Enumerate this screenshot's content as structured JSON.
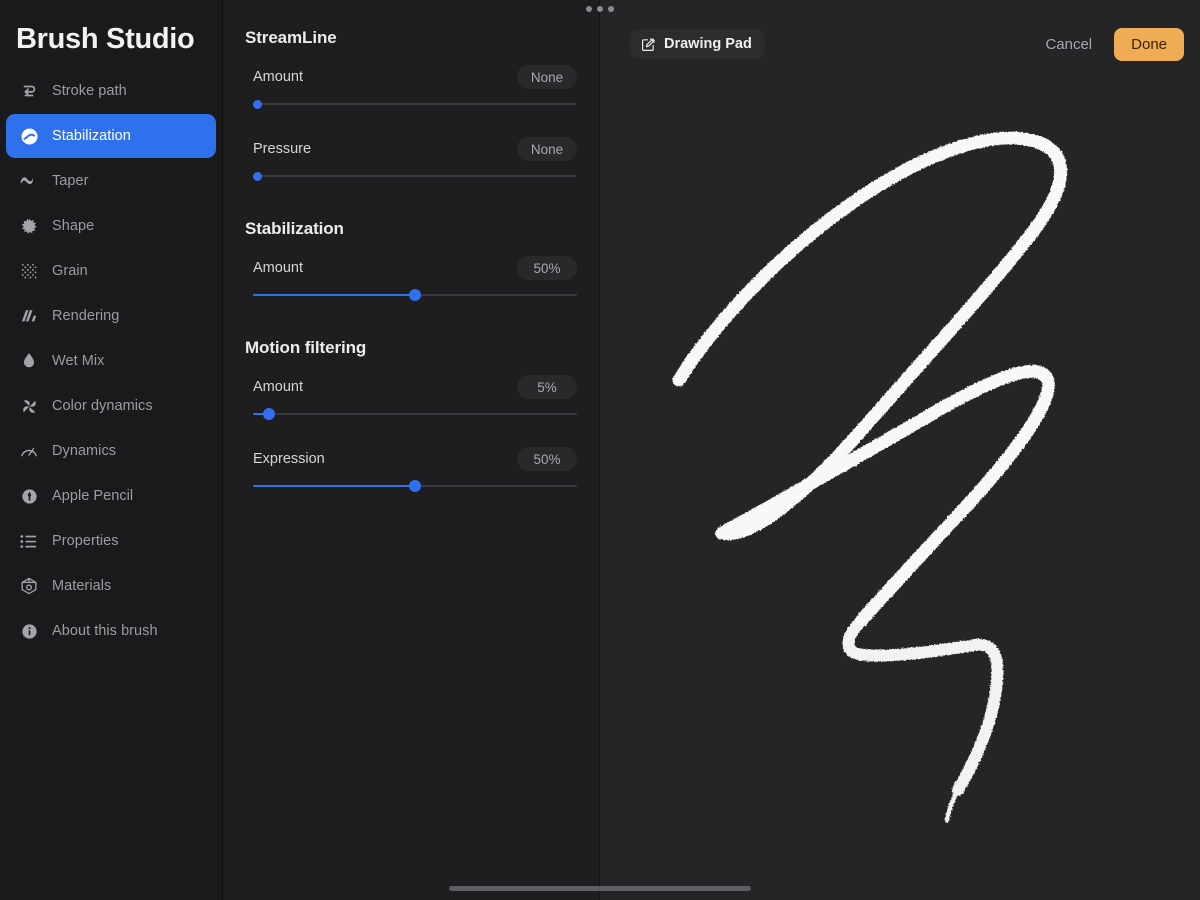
{
  "window": {
    "grabber_dots": 3,
    "home_indicator": true
  },
  "sidebar": {
    "brand": "Brush Studio",
    "items": [
      {
        "label": "Stroke path",
        "icon": "stroke-path-icon",
        "active": false
      },
      {
        "label": "Stabilization",
        "icon": "stabilization-icon",
        "active": true
      },
      {
        "label": "Taper",
        "icon": "taper-icon",
        "active": false
      },
      {
        "label": "Shape",
        "icon": "shape-icon",
        "active": false
      },
      {
        "label": "Grain",
        "icon": "grain-icon",
        "active": false
      },
      {
        "label": "Rendering",
        "icon": "rendering-icon",
        "active": false
      },
      {
        "label": "Wet Mix",
        "icon": "wet-mix-icon",
        "active": false
      },
      {
        "label": "Color dynamics",
        "icon": "color-dynamics-icon",
        "active": false
      },
      {
        "label": "Dynamics",
        "icon": "dynamics-icon",
        "active": false
      },
      {
        "label": "Apple Pencil",
        "icon": "apple-pencil-icon",
        "active": false
      },
      {
        "label": "Properties",
        "icon": "properties-icon",
        "active": false
      },
      {
        "label": "Materials",
        "icon": "materials-icon",
        "active": false
      },
      {
        "label": "About this brush",
        "icon": "info-icon",
        "active": false
      }
    ]
  },
  "settings": {
    "sections": [
      {
        "title": "StreamLine",
        "sliders": [
          {
            "label": "Amount",
            "value_text": "None",
            "percent": 0
          },
          {
            "label": "Pressure",
            "value_text": "None",
            "percent": 0
          }
        ]
      },
      {
        "title": "Stabilization",
        "sliders": [
          {
            "label": "Amount",
            "value_text": "50%",
            "percent": 50
          }
        ]
      },
      {
        "title": "Motion filtering",
        "sliders": [
          {
            "label": "Amount",
            "value_text": "5%",
            "percent": 5
          },
          {
            "label": "Expression",
            "value_text": "50%",
            "percent": 50
          }
        ]
      }
    ]
  },
  "canvas": {
    "pad_chip_label": "Drawing Pad",
    "pad_chip_icon": "compose-icon",
    "cancel_label": "Cancel",
    "done_label": "Done",
    "stroke_color": "#f2f2f4",
    "background_color": "#252528"
  },
  "colors": {
    "accent_blue": "#2f70ed",
    "accent_orange": "#f0ab55",
    "sidebar_bg": "#1a1a1c",
    "panel_bg": "#1e1e20",
    "canvas_bg": "#252528"
  }
}
